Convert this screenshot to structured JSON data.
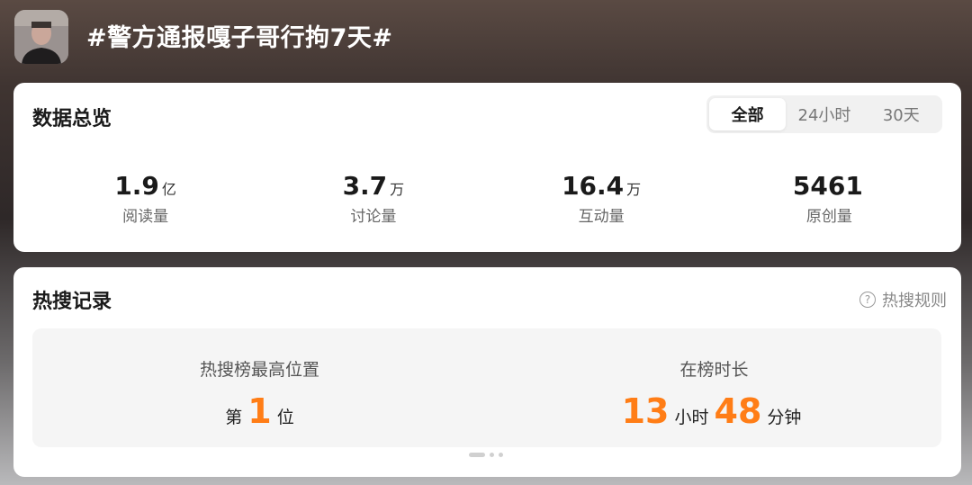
{
  "header": {
    "topic_title": "#警方通报嘎子哥行拘7天#",
    "avatar_icon": "user-avatar-icon"
  },
  "overview": {
    "title": "数据总览",
    "tabs": [
      {
        "label": "全部",
        "active": true
      },
      {
        "label": "24小时",
        "active": false
      },
      {
        "label": "30天",
        "active": false
      }
    ],
    "metrics": [
      {
        "value": "1.9",
        "unit": "亿",
        "label": "阅读量"
      },
      {
        "value": "3.7",
        "unit": "万",
        "label": "讨论量"
      },
      {
        "value": "16.4",
        "unit": "万",
        "label": "互动量"
      },
      {
        "value": "5461",
        "unit": "",
        "label": "原创量"
      }
    ]
  },
  "hotsearch": {
    "title": "热搜记录",
    "rules_label": "热搜规则",
    "rules_icon": "question-circle-icon",
    "records": {
      "peak": {
        "label": "热搜榜最高位置",
        "prefix": "第",
        "value": "1",
        "suffix": "位"
      },
      "duration": {
        "label": "在榜时长",
        "hours": "13",
        "hours_unit": "小时",
        "minutes": "48",
        "minutes_unit": "分钟"
      }
    },
    "pager": {
      "pages": 3,
      "active": 1
    }
  },
  "colors": {
    "accent": "#ff7d16",
    "card": "#ffffff",
    "record_box": "#f5f5f5"
  }
}
